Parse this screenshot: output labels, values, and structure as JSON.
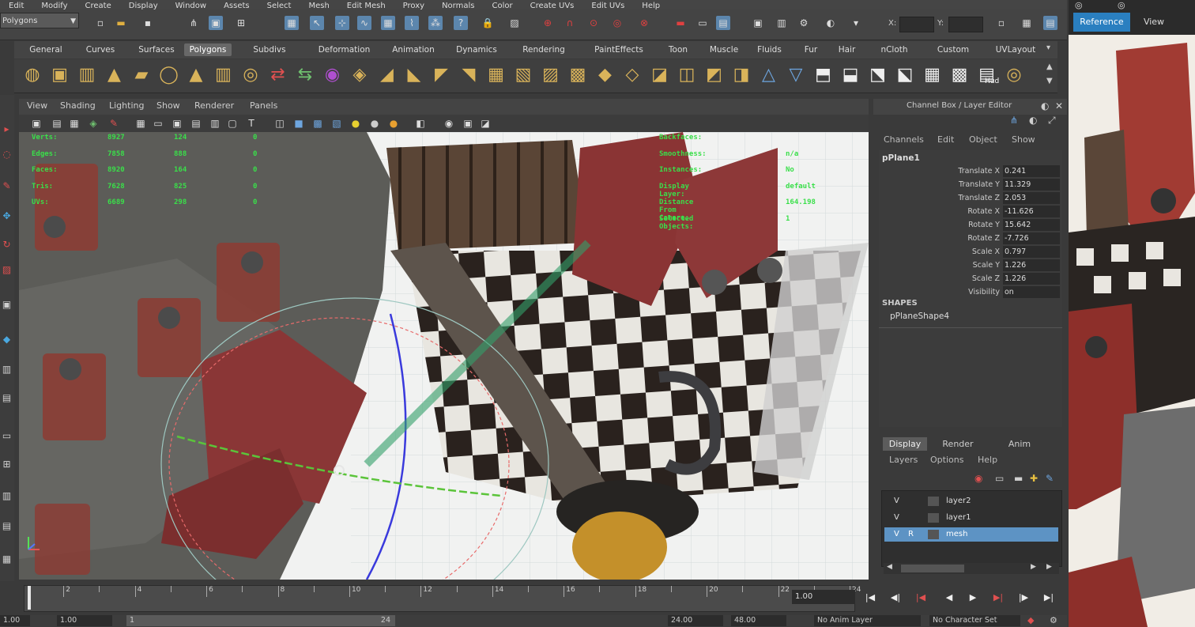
{
  "menubar": [
    "Edit",
    "Modify",
    "Create",
    "Display",
    "Window",
    "Assets",
    "Select",
    "Mesh",
    "Edit Mesh",
    "Proxy",
    "Normals",
    "Color",
    "Create UVs",
    "Edit UVs",
    "Help"
  ],
  "status_line": {
    "mode": "Polygons",
    "x_label": "X:",
    "y_label": "Y:"
  },
  "shelf_tabs": [
    "General",
    "Curves",
    "Surfaces",
    "Polygons",
    "Subdivs",
    "Deformation",
    "Animation",
    "Dynamics",
    "Rendering",
    "PaintEffects",
    "Toon",
    "Muscle",
    "Fluids",
    "Fur",
    "Hair",
    "nCloth",
    "Custom",
    "UVLayout"
  ],
  "active_shelf_tab": "Polygons",
  "shelf_icons": [
    "sphere-icon",
    "cube-icon",
    "cylinder-icon",
    "cone-icon",
    "plane-icon",
    "torus-icon",
    "pyramid-icon",
    "pipe-icon",
    "helix-icon",
    "combine-icon",
    "separate-icon",
    "smooth-icon",
    "mirror-icon",
    "extrude-icon",
    "bridge-icon",
    "append-icon",
    "split-icon",
    "insert-edgeloop-icon",
    "offset-edgeloop-icon",
    "bevel-icon",
    "merge-icon",
    "wedge-icon",
    "poke-icon",
    "chamfer-icon",
    "soften-icon",
    "harden-icon",
    "fill-hole-icon",
    "triangulate-icon",
    "quadrangulate-icon",
    "uv-planar-icon",
    "uv-cylindrical-icon",
    "uv-spherical-icon",
    "uv-automatic-icon",
    "uv-layout-icon",
    "checker-icon",
    "hud-icon",
    "texture-icon"
  ],
  "shelf_icon_label": "Hud",
  "viewport": {
    "menu": [
      "View",
      "Shading",
      "Lighting",
      "Show",
      "Renderer",
      "Panels"
    ],
    "hud_counts": [
      [
        "Verts:",
        "8927",
        "124",
        "0"
      ],
      [
        "Edges:",
        "7858",
        "888",
        "0"
      ],
      [
        "Faces:",
        "8920",
        "164",
        "0"
      ],
      [
        "Tris:",
        "7628",
        "825",
        "0"
      ],
      [
        "UVs:",
        "6689",
        "298",
        "0"
      ]
    ],
    "hud_right_labels": [
      "Backfaces:",
      "Smoothness:",
      "Instances:",
      "Display Layer:",
      "Distance From Camera:",
      "Selected Objects:"
    ],
    "hud_right_values": [
      "",
      "n/a",
      "No",
      "default",
      "164.198",
      "1"
    ],
    "colors": {
      "hud": "#3adf4a",
      "background": "#8a8a84"
    }
  },
  "channel_box": {
    "title": "Channel Box / Layer Editor",
    "menu": [
      "Channels",
      "Edit",
      "Object",
      "Show"
    ],
    "object": "pPlane1",
    "attributes": [
      {
        "name": "Translate X",
        "value": "0.241"
      },
      {
        "name": "Translate Y",
        "value": "11.329"
      },
      {
        "name": "Translate Z",
        "value": "2.053"
      },
      {
        "name": "Rotate X",
        "value": "-11.626"
      },
      {
        "name": "Rotate Y",
        "value": "15.642"
      },
      {
        "name": "Rotate Z",
        "value": "-7.726"
      },
      {
        "name": "Scale X",
        "value": "0.797"
      },
      {
        "name": "Scale Y",
        "value": "1.226"
      },
      {
        "name": "Scale Z",
        "value": "1.226"
      },
      {
        "name": "Visibility",
        "value": "on"
      }
    ],
    "shapes_header": "SHAPES",
    "shape": "pPlaneShape4"
  },
  "layer_editor": {
    "tabs": [
      "Display",
      "Render",
      "Anim"
    ],
    "active_tab": "Display",
    "menu": [
      "Layers",
      "Options",
      "Help"
    ],
    "layers": [
      {
        "v": "V",
        "p": "",
        "name": "layer2",
        "selected": false
      },
      {
        "v": "V",
        "p": "",
        "name": "layer1",
        "selected": false
      },
      {
        "v": "V",
        "p": "R",
        "name": "mesh",
        "selected": true
      }
    ]
  },
  "time_slider": {
    "ticks": [
      "2",
      "4",
      "6",
      "8",
      "10",
      "12",
      "14",
      "16",
      "18",
      "20",
      "22",
      "24"
    ],
    "current_frame": "1.00",
    "start_time": "1.00",
    "range_start": "1",
    "range_end": "24",
    "end_time": "24.00",
    "end_time2": "48.00",
    "anim_layer": "No Anim Layer",
    "character_set": "No Character Set"
  },
  "reference_panel": {
    "tab_active": "Reference",
    "tab_other": "View"
  }
}
